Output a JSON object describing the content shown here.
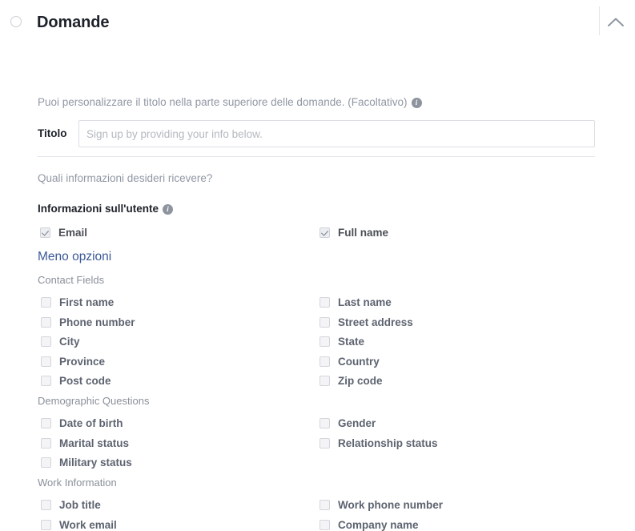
{
  "header": {
    "title": "Domande",
    "radio_name": "section-radio",
    "collapse_icon": "chevron-up-icon"
  },
  "intro": {
    "help_text": "Puoi personalizzare il titolo nella parte superiore delle domande. (Facoltativo)",
    "info_icon": "info-icon",
    "titolo_label": "Titolo",
    "titolo_value": "",
    "titolo_placeholder": "Sign up by providing your info below."
  },
  "questions": {
    "prompt": "Quali informazioni desideri ricevere?",
    "group_heading": "Informazioni sull'utente",
    "group_info_icon": "info-icon",
    "primary_fields": [
      {
        "label": "Email",
        "checked": true
      },
      {
        "label": "Full name",
        "checked": true
      }
    ],
    "toggle_link": "Meno opzioni",
    "sections": [
      {
        "heading": "Contact Fields",
        "left": [
          {
            "label": "First name",
            "checked": false
          },
          {
            "label": "Phone number",
            "checked": false
          },
          {
            "label": "City",
            "checked": false
          },
          {
            "label": "Province",
            "checked": false
          },
          {
            "label": "Post code",
            "checked": false
          }
        ],
        "right": [
          {
            "label": "Last name",
            "checked": false
          },
          {
            "label": "Street address",
            "checked": false
          },
          {
            "label": "State",
            "checked": false
          },
          {
            "label": "Country",
            "checked": false
          },
          {
            "label": "Zip code",
            "checked": false
          }
        ]
      },
      {
        "heading": "Demographic Questions",
        "left": [
          {
            "label": "Date of birth",
            "checked": false
          },
          {
            "label": "Marital status",
            "checked": false
          },
          {
            "label": "Military status",
            "checked": false
          }
        ],
        "right": [
          {
            "label": "Gender",
            "checked": false
          },
          {
            "label": "Relationship status",
            "checked": false
          }
        ]
      },
      {
        "heading": "Work Information",
        "left": [
          {
            "label": "Job title",
            "checked": false
          },
          {
            "label": "Work email",
            "checked": false
          }
        ],
        "right": [
          {
            "label": "Work phone number",
            "checked": false
          },
          {
            "label": "Company name",
            "checked": false
          }
        ]
      }
    ]
  },
  "colors": {
    "link_blue": "#3b5998",
    "heading_dark": "#1d2129",
    "muted_gray": "#9197a3",
    "label_gray": "#5d6370",
    "border_gray": "#e4e6eb"
  }
}
